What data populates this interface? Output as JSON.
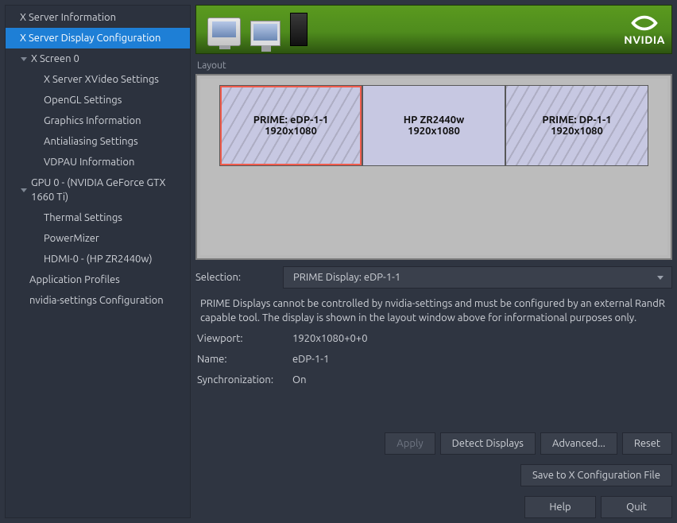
{
  "sidebar": {
    "items": [
      {
        "label": "X Server Information",
        "depth": 0,
        "expandable": false,
        "selected": false
      },
      {
        "label": "X Server Display Configuration",
        "depth": 0,
        "expandable": false,
        "selected": true
      },
      {
        "label": "X Screen 0",
        "depth": 0,
        "expandable": true,
        "selected": false
      },
      {
        "label": "X Server XVideo Settings",
        "depth": 2,
        "expandable": false,
        "selected": false
      },
      {
        "label": "OpenGL Settings",
        "depth": 2,
        "expandable": false,
        "selected": false
      },
      {
        "label": "Graphics Information",
        "depth": 2,
        "expandable": false,
        "selected": false
      },
      {
        "label": "Antialiasing Settings",
        "depth": 2,
        "expandable": false,
        "selected": false
      },
      {
        "label": "VDPAU Information",
        "depth": 2,
        "expandable": false,
        "selected": false
      },
      {
        "label": "GPU 0 - (NVIDIA GeForce GTX 1660 Ti)",
        "depth": 0,
        "expandable": true,
        "selected": false
      },
      {
        "label": "Thermal Settings",
        "depth": 2,
        "expandable": false,
        "selected": false
      },
      {
        "label": "PowerMizer",
        "depth": 2,
        "expandable": false,
        "selected": false
      },
      {
        "label": "HDMI-0 - (HP ZR2440w)",
        "depth": 2,
        "expandable": false,
        "selected": false
      },
      {
        "label": "Application Profiles",
        "depth": 1,
        "expandable": false,
        "selected": false
      },
      {
        "label": "nvidia-settings Configuration",
        "depth": 1,
        "expandable": false,
        "selected": false
      }
    ]
  },
  "banner": {
    "brand": "NVIDIA"
  },
  "layout": {
    "label": "Layout",
    "displays": [
      {
        "name": "PRIME: eDP-1-1",
        "resolution": "1920x1080",
        "selected": true,
        "hatched": true
      },
      {
        "name": "HP ZR2440w",
        "resolution": "1920x1080",
        "selected": false,
        "hatched": false
      },
      {
        "name": "PRIME: DP-1-1",
        "resolution": "1920x1080",
        "selected": false,
        "hatched": true
      }
    ]
  },
  "selection": {
    "label": "Selection:",
    "value": "PRIME Display: eDP-1-1"
  },
  "info_text": "PRIME Displays cannot be controlled by nvidia-settings and must be configured by an external RandR capable tool. The display is shown in the layout window above for informational purposes only.",
  "props": {
    "viewport_label": "Viewport:",
    "viewport_value": "1920x1080+0+0",
    "name_label": "Name:",
    "name_value": "eDP-1-1",
    "sync_label": "Synchronization:",
    "sync_value": "On"
  },
  "buttons": {
    "apply": "Apply",
    "detect": "Detect Displays",
    "advanced": "Advanced...",
    "reset": "Reset",
    "save": "Save to X Configuration File",
    "help": "Help",
    "quit": "Quit"
  }
}
